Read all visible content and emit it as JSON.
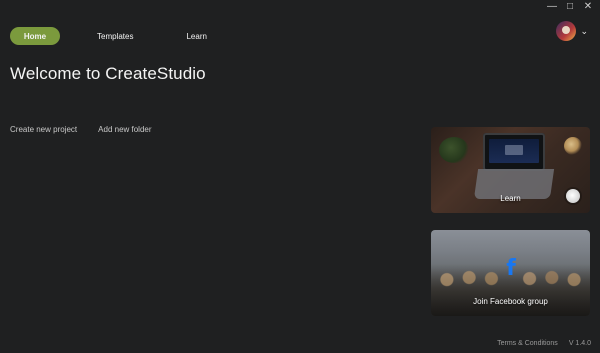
{
  "window": {
    "minimize": "—",
    "maximize": "□",
    "close": "✕"
  },
  "nav": {
    "home_label": "Home",
    "templates_label": "Templates",
    "learn_label": "Learn"
  },
  "profile": {
    "chevron": "⌄"
  },
  "main": {
    "title": "Welcome to CreateStudio",
    "actions": {
      "create_project": "Create new project",
      "add_folder": "Add new folder"
    }
  },
  "cards": {
    "learn": {
      "label": "Learn"
    },
    "facebook": {
      "logo": "f",
      "label": "Join Facebook group"
    }
  },
  "footer": {
    "terms": "Terms & Conditions",
    "version": "V 1.4.0"
  },
  "colors": {
    "background": "#1f2021",
    "nav_active": "#7b9a3d",
    "text_primary": "#f4f4f4",
    "text_muted": "#c9c9c9",
    "facebook_blue": "#1877f2"
  },
  "icons": {
    "avatar": "avatar",
    "chevron_down": "chevron-down-icon",
    "facebook_logo": "facebook-icon",
    "window_minimize": "minimize-icon",
    "window_maximize": "maximize-icon",
    "window_close": "close-icon"
  }
}
